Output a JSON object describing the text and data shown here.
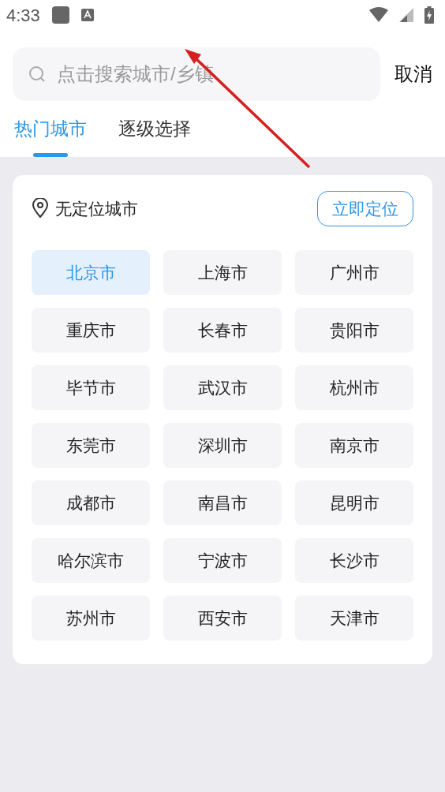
{
  "status_bar": {
    "time": "4:33"
  },
  "search": {
    "placeholder": "点击搜索城市/乡镇",
    "cancel": "取消"
  },
  "tabs": [
    {
      "label": "热门城市",
      "selected": true
    },
    {
      "label": "逐级选择",
      "selected": false
    }
  ],
  "location": {
    "label": "无定位城市",
    "button": "立即定位"
  },
  "cities": [
    {
      "name": "北京市",
      "selected": true
    },
    {
      "name": "上海市",
      "selected": false
    },
    {
      "name": "广州市",
      "selected": false
    },
    {
      "name": "重庆市",
      "selected": false
    },
    {
      "name": "长春市",
      "selected": false
    },
    {
      "name": "贵阳市",
      "selected": false
    },
    {
      "name": "毕节市",
      "selected": false
    },
    {
      "name": "武汉市",
      "selected": false
    },
    {
      "name": "杭州市",
      "selected": false
    },
    {
      "name": "东莞市",
      "selected": false
    },
    {
      "name": "深圳市",
      "selected": false
    },
    {
      "name": "南京市",
      "selected": false
    },
    {
      "name": "成都市",
      "selected": false
    },
    {
      "name": "南昌市",
      "selected": false
    },
    {
      "name": "昆明市",
      "selected": false
    },
    {
      "name": "哈尔滨市",
      "selected": false
    },
    {
      "name": "宁波市",
      "selected": false
    },
    {
      "name": "长沙市",
      "selected": false
    },
    {
      "name": "苏州市",
      "selected": false
    },
    {
      "name": "西安市",
      "selected": false
    },
    {
      "name": "天津市",
      "selected": false
    }
  ]
}
